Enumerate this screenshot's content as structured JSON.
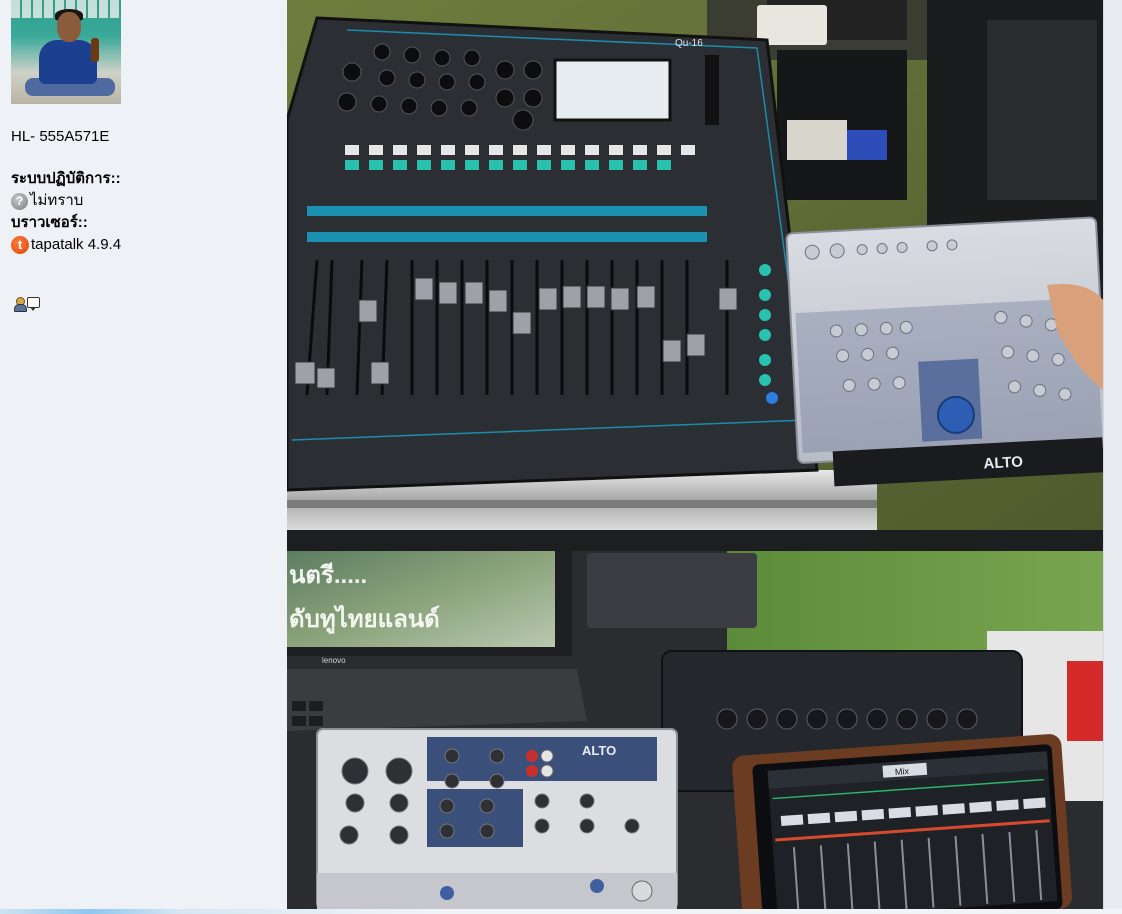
{
  "profile": {
    "avatar_alt": "user-avatar",
    "device_id": "HL- 555A571E",
    "os_label": "ระบบปฏิบัติการ::",
    "os_value": "ไม่ทราบ",
    "browser_label": "บราวเซอร์::",
    "browser_value": "tapatalk 4.9.4"
  },
  "icons": {
    "os_icon": "question-mark-icon",
    "browser_icon": "tapatalk-icon",
    "profile_icon": "user-profile-icon",
    "message_icon": "private-message-icon",
    "q_glyph": "?",
    "t_glyph": "t"
  },
  "photos": {
    "top": {
      "name": "digital-mixer-photo",
      "qu_model": "Qu-16",
      "alto_brand": "ALTO"
    },
    "bottom": {
      "name": "mixer-tablet-photo",
      "screen_text_1": "นตรี.....",
      "screen_text_2": "ดับทูไทยแลนด์",
      "laptop_brand": "lenovo",
      "alto_brand": "ALTO",
      "tablet_label": "Mix"
    }
  },
  "colors": {
    "sidebar_bg": "#eef1f6",
    "mixer_accent": "#1aa3c9",
    "alto_panel": "#3a4f7a",
    "tapatalk_orange": "#e35b14"
  }
}
